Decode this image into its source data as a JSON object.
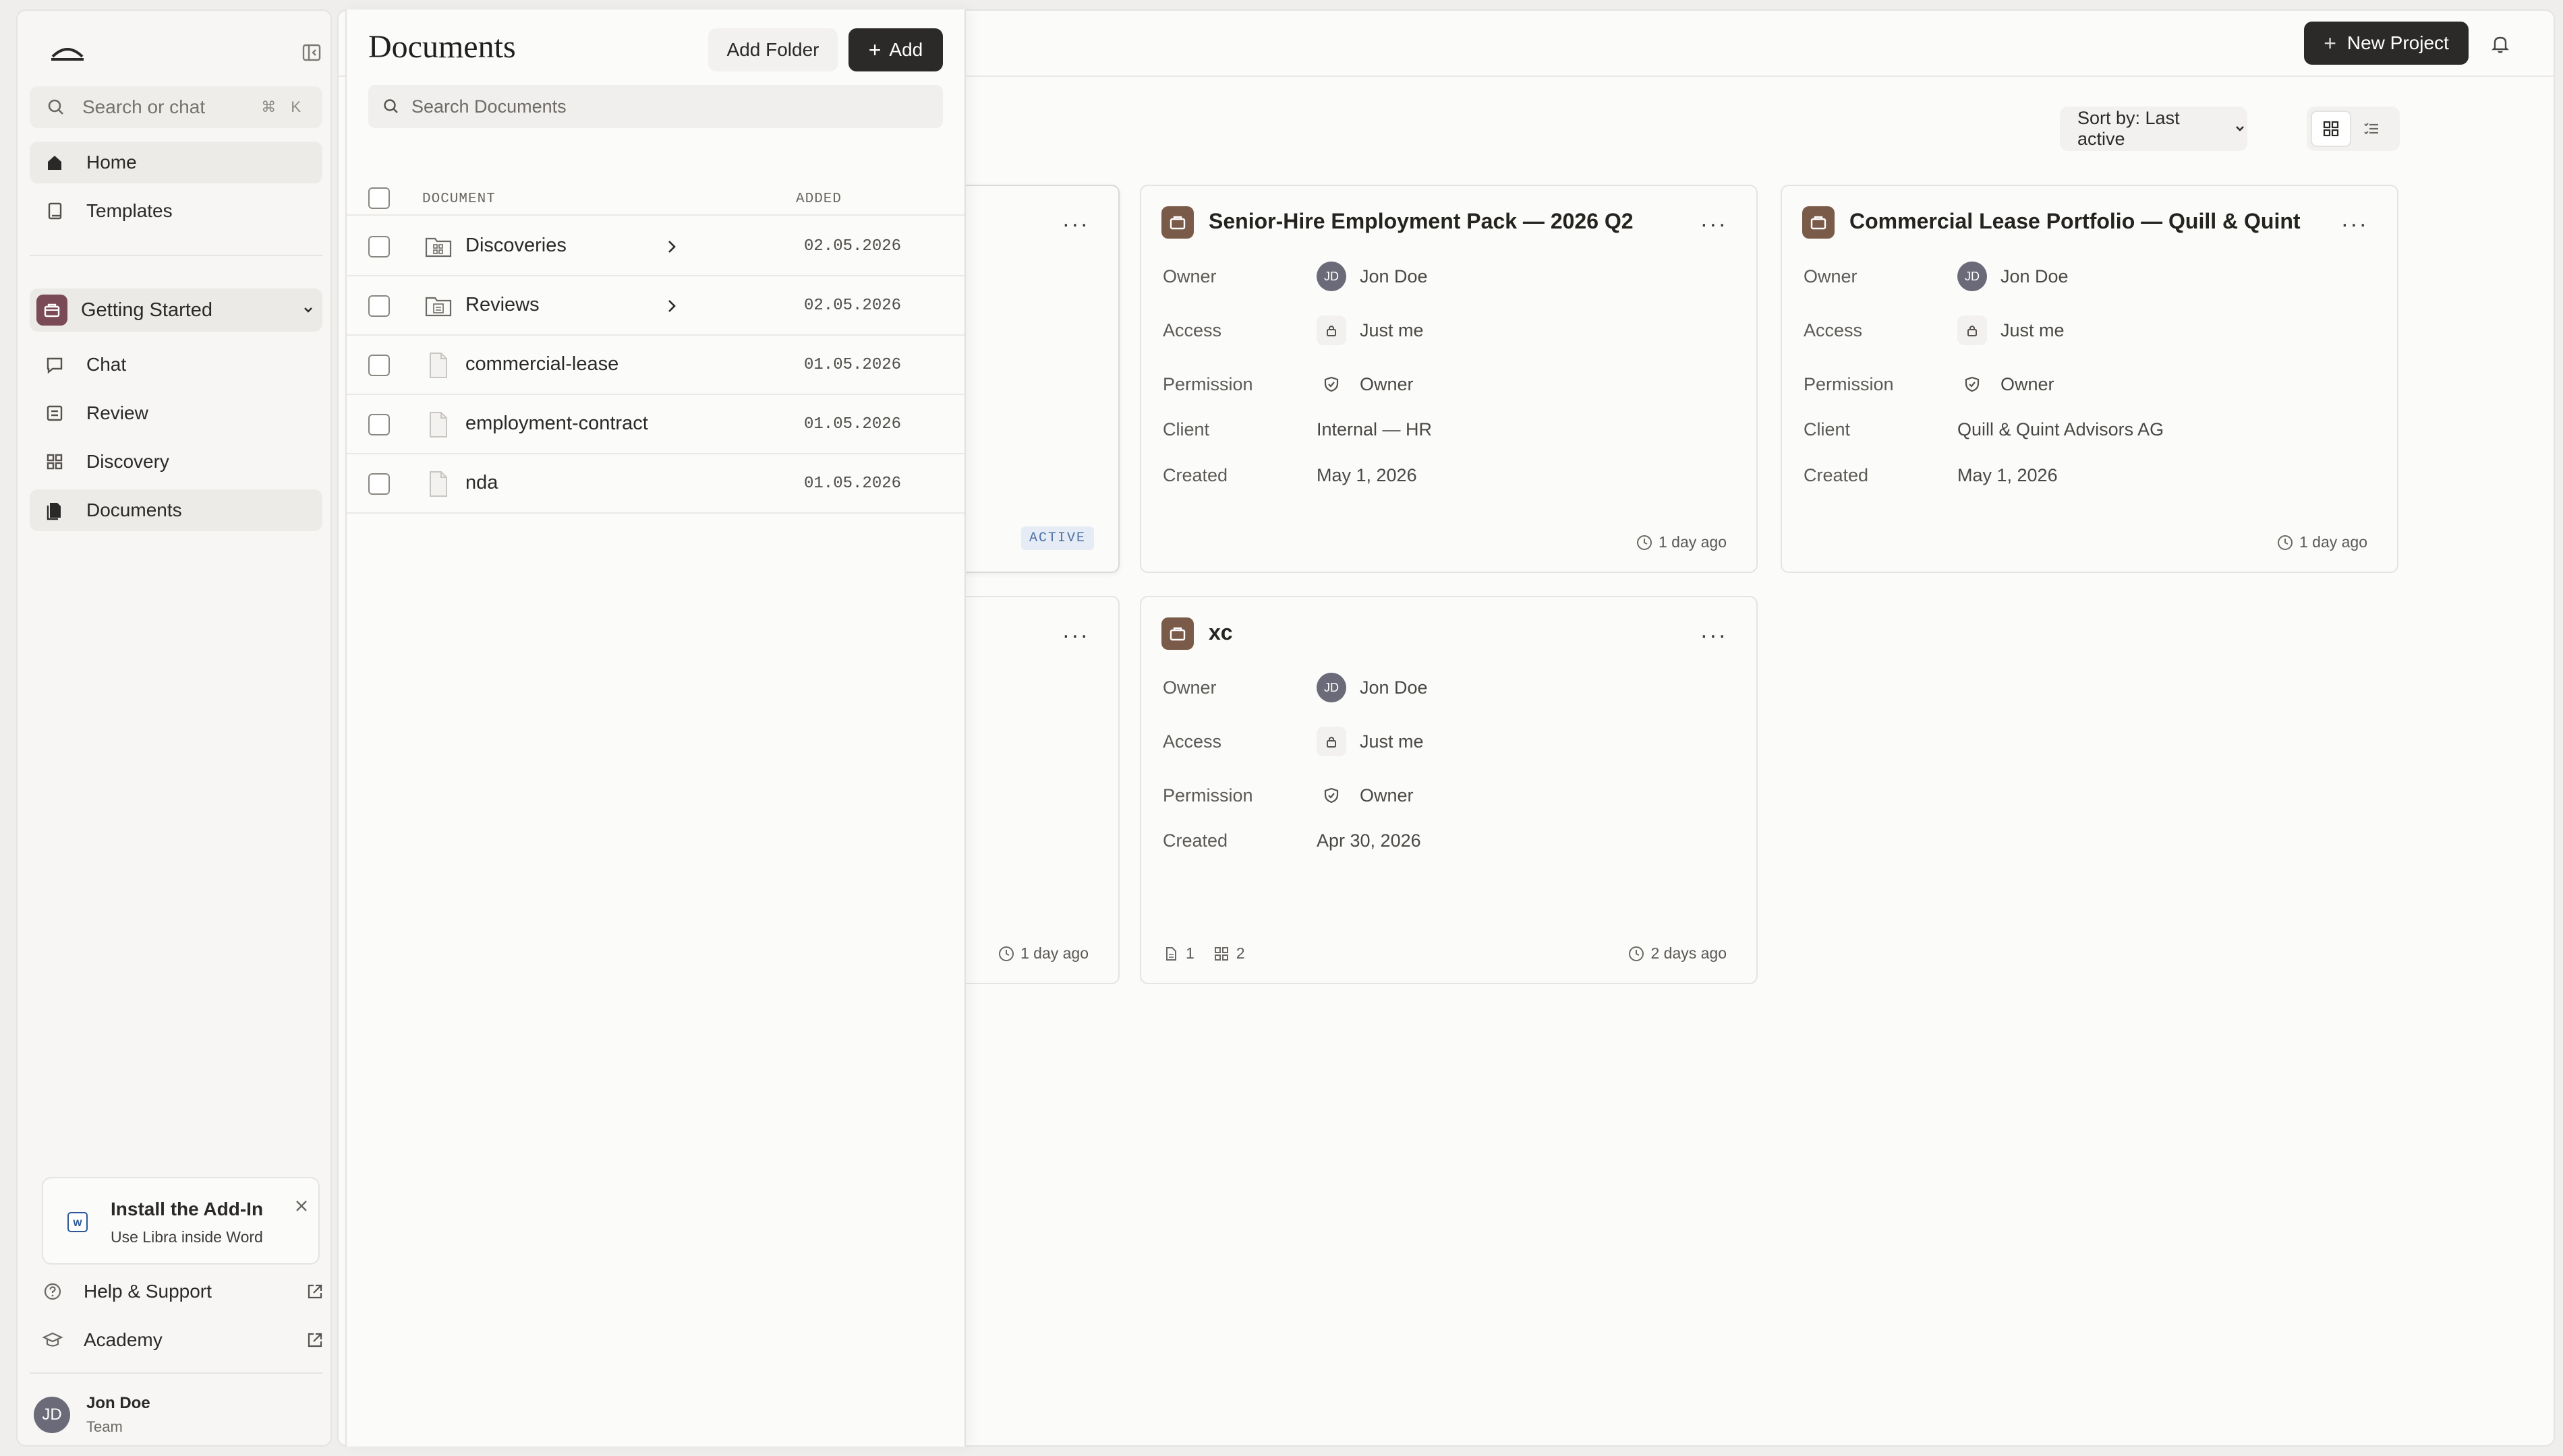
{
  "sidebar": {
    "search_placeholder": "Search or chat",
    "search_shortcut": "⌘ K",
    "nav_top": [
      {
        "label": "Home",
        "icon": "home-icon",
        "active": true
      },
      {
        "label": "Templates",
        "icon": "book-icon",
        "active": false
      }
    ],
    "project": {
      "label": "Getting Started"
    },
    "nav_project": [
      {
        "label": "Chat",
        "icon": "chat-icon"
      },
      {
        "label": "Review",
        "icon": "review-icon"
      },
      {
        "label": "Discovery",
        "icon": "grid-icon"
      },
      {
        "label": "Documents",
        "icon": "documents-icon",
        "active": true
      }
    ],
    "addin": {
      "title": "Install the Add-In",
      "subtitle": "Use Libra inside Word"
    },
    "footer_links": [
      {
        "label": "Help & Support",
        "icon": "help-icon"
      },
      {
        "label": "Academy",
        "icon": "academy-icon"
      }
    ],
    "user": {
      "initials": "JD",
      "name": "Jon Doe",
      "role": "Team"
    }
  },
  "topbar": {
    "new_project_label": "New Project"
  },
  "toolbar": {
    "sort_label": "Sort by: Last active"
  },
  "documents_panel": {
    "title": "Documents",
    "add_folder_label": "Add Folder",
    "add_label": "Add",
    "search_placeholder": "Search Documents",
    "columns": {
      "document": "DOCUMENT",
      "added": "ADDED"
    },
    "rows": [
      {
        "name": "Discoveries",
        "type": "folder",
        "added": "02.05.2026"
      },
      {
        "name": "Reviews",
        "type": "folder",
        "added": "02.05.2026"
      },
      {
        "name": "commercial-lease",
        "type": "file",
        "added": "01.05.2026"
      },
      {
        "name": "employment-contract",
        "type": "file",
        "added": "01.05.2026"
      },
      {
        "name": "nda",
        "type": "file",
        "added": "01.05.2026"
      }
    ]
  },
  "cards": [
    {
      "title": "",
      "footer": "",
      "badge": "ACTIVE"
    },
    {
      "title": "Senior-Hire Employment Pack — 2026 Q2",
      "fields": {
        "owner_label": "Owner",
        "owner_initials": "JD",
        "owner": "Jon Doe",
        "access_label": "Access",
        "access": "Just me",
        "permission_label": "Permission",
        "permission": "Owner",
        "client_label": "Client",
        "client": "Internal — HR",
        "created_label": "Created",
        "created": "May 1, 2026"
      },
      "footer": "1 day ago"
    },
    {
      "title": "Commercial Lease Portfolio — Quill & Quint",
      "fields": {
        "owner_label": "Owner",
        "owner_initials": "JD",
        "owner": "Jon Doe",
        "access_label": "Access",
        "access": "Just me",
        "permission_label": "Permission",
        "permission": "Owner",
        "client_label": "Client",
        "client": "Quill & Quint Advisors AG",
        "created_label": "Created",
        "created": "May 1, 2026"
      },
      "footer": "1 day ago"
    },
    {
      "title": "",
      "footer": "1 day ago"
    },
    {
      "title": "xc",
      "fields": {
        "owner_label": "Owner",
        "owner_initials": "JD",
        "owner": "Jon Doe",
        "access_label": "Access",
        "access": "Just me",
        "permission_label": "Permission",
        "permission": "Owner",
        "created_label": "Created",
        "created": "Apr 30, 2026"
      },
      "doc_count": "1",
      "review_count": "2",
      "footer": "2 days ago"
    }
  ],
  "colors": {
    "accent_dark": "#2b2a28",
    "project_badge": "#7a4a57",
    "card_badge": "#7a5a48",
    "active_tag": "#4a6fa3"
  }
}
